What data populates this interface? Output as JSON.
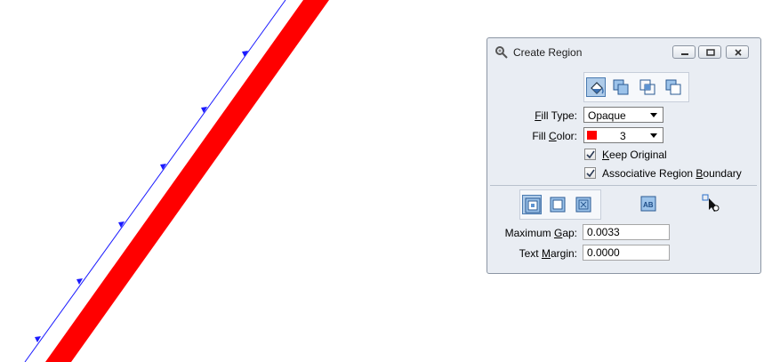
{
  "dialog": {
    "title": "Create Region",
    "window_buttons": [
      "minimize-icon",
      "restore-icon",
      "close-icon"
    ]
  },
  "method_icons": [
    "flood-fill-icon",
    "union-icon",
    "intersection-icon",
    "difference-icon"
  ],
  "fill_type": {
    "label_pre": "",
    "label_u": "F",
    "label_post": "ill Type:",
    "value": "Opaque"
  },
  "fill_color": {
    "label_pre": "Fill ",
    "label_u": "C",
    "label_post": "olor:",
    "value": "3",
    "swatch": "#ff0000"
  },
  "keep_original": {
    "label_pre": "",
    "label_u": "K",
    "label_post": "eep Original",
    "checked": true
  },
  "assoc_boundary": {
    "label_pre": "Associative Region ",
    "label_u": "B",
    "label_post": "oundary",
    "checked": true
  },
  "flood_icons": [
    "locate-interior-shapes-icon",
    "dynamic-area-icon",
    "ignore-interior-icon",
    "text-islands-icon",
    "locate-point-icon"
  ],
  "max_gap": {
    "label_pre": "Maximum ",
    "label_u": "G",
    "label_post": "ap:",
    "value": "0.0033"
  },
  "text_margin": {
    "label_pre": "Text ",
    "label_u": "M",
    "label_post": "argin:",
    "value": "0.0000"
  },
  "colors": {
    "thin_line": "#1a1aff",
    "thick_line": "#ff0000",
    "accent": "#4a7ab0"
  }
}
